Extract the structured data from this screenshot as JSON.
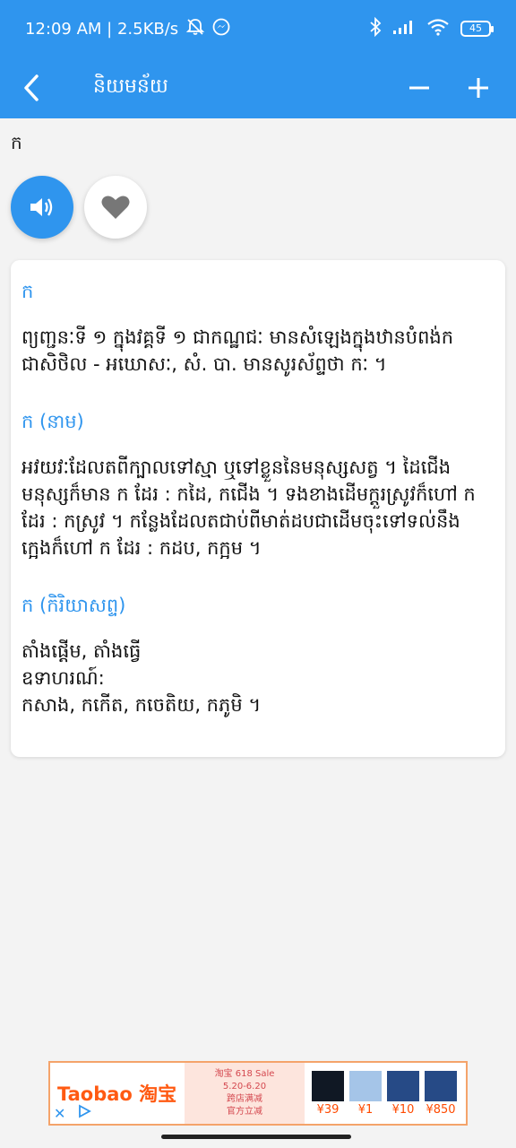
{
  "status_bar": {
    "time_speed": "12:09 AM | 2.5KB/s",
    "battery": "45",
    "icons": [
      "mute-icon",
      "messenger-icon",
      "bluetooth-icon",
      "signal-icon",
      "wifi-icon",
      "battery-icon"
    ]
  },
  "app_bar": {
    "title": "និយមន័យ",
    "back_icon": "chevron-left-icon",
    "zoom_out_icon": "minus-icon",
    "zoom_in_icon": "plus-icon"
  },
  "word": "ក",
  "actions": {
    "speak_icon": "speaker-icon",
    "favorite_icon": "heart-icon"
  },
  "entries": [
    {
      "title": "ក",
      "lines": [
        "ព្យញ្ជនៈទី ១ ក្នុងវគ្គទី ១ ជាកណ្ឋជៈ មានសំឡេងក្នុងឋានបំពង់ក",
        "ជាសិថិល - អឃោសៈ, សំ. បា. មានសូរស័ព្ទថា កៈ ។"
      ]
    },
    {
      "title": "ក (នាម)",
      "lines": [
        "អវយវៈដែលតពីក្បាលទៅស្មា ឬទៅខ្លួននៃមនុស្សសត្វ ។ ដៃជើង",
        "មនុស្សក៏មាន ក ដែរ : កដៃ, កជើង ។ ទងខាងដើមក្ដួរស្រូវក៏ហៅ ក",
        "ដែរ : កស្រូវ ។ កន្លែងដែលតជាប់ពីមាត់ដបជាដើមចុះទៅទល់នឹង",
        "ក្អេងក៏ហៅ ក ដែរ : កដប, កក្អម ។"
      ]
    },
    {
      "title": "ក (កិរិយាសព្ទ)",
      "lines": [
        "តាំងផ្ដើម, តាំងធ្វើ",
        "ឧទាហរណ៍:",
        "កសាង, កកើត, កចេតិយ, កភូមិ ។"
      ]
    }
  ],
  "ad": {
    "logo": "Taobao 淘宝",
    "promo_title": "淘宝 618 Sale",
    "promo_dates": "5.20-6.20",
    "promo_line1": "跨店满减",
    "promo_line2": "官方立减",
    "prices": [
      "¥39",
      "¥1",
      "¥10",
      "¥850"
    ],
    "close_icon": "close-icon",
    "adchoices_icon": "adchoices-icon"
  }
}
